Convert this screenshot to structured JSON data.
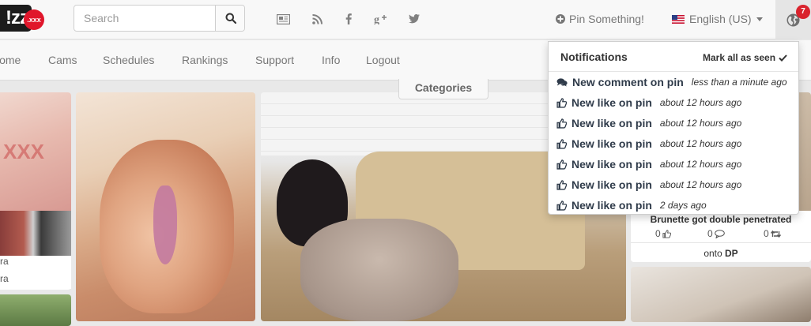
{
  "header": {
    "logo_text": "!zz",
    "logo_badge": ".xxx",
    "search": {
      "placeholder": "Search"
    },
    "social_icons": [
      "newspaper-icon",
      "rss-icon",
      "facebook-icon",
      "google-plus-icon",
      "twitter-icon"
    ],
    "pin_something": "Pin Something!",
    "language": "English (US)",
    "notification_count": "7"
  },
  "nav": {
    "items": [
      "Home",
      "Cams",
      "Schedules",
      "Rankings",
      "Support",
      "Info",
      "Logout"
    ],
    "categories": "Categories"
  },
  "notifications": {
    "title": "Notifications",
    "mark_all": "Mark all as seen",
    "items": [
      {
        "icon": "comments-icon",
        "text": "New comment on pin",
        "time": "less than a minute ago"
      },
      {
        "icon": "thumbs-up-icon",
        "text": "New like on pin",
        "time": "about 12 hours ago"
      },
      {
        "icon": "thumbs-up-icon",
        "text": "New like on pin",
        "time": "about 12 hours ago"
      },
      {
        "icon": "thumbs-up-icon",
        "text": "New like on pin",
        "time": "about 12 hours ago"
      },
      {
        "icon": "thumbs-up-icon",
        "text": "New like on pin",
        "time": "about 12 hours ago"
      },
      {
        "icon": "thumbs-up-icon",
        "text": "New like on pin",
        "time": "about 12 hours ago"
      },
      {
        "icon": "thumbs-up-icon",
        "text": "New like on pin",
        "time": "2 days ago"
      }
    ]
  },
  "right_card": {
    "title": "Brunette got double penetrated",
    "likes": "0",
    "comments": "0",
    "repins": "0",
    "onto_prefix": "onto",
    "board": "DP"
  },
  "left_card": {
    "caption_1": "ra",
    "caption_2": "ra",
    "watermark": "XXX"
  },
  "colors": {
    "notif_badge": "#d9232d",
    "logo_red": "#e0162b",
    "nav_text": "#777777",
    "notif_text": "#2f3b4a"
  }
}
